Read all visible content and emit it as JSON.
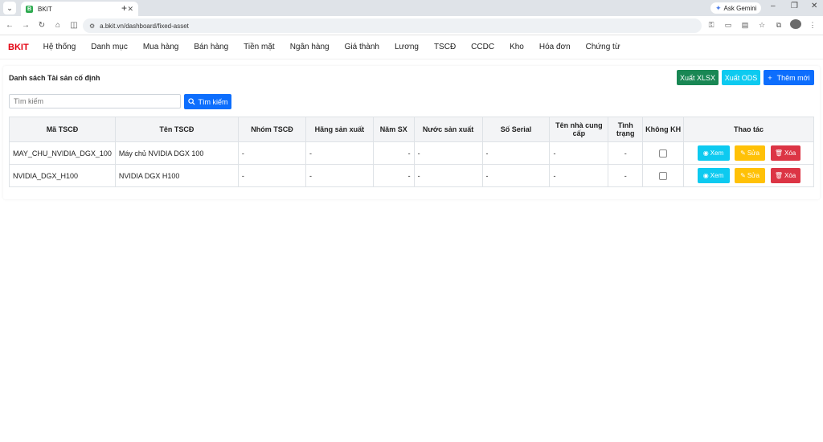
{
  "browser": {
    "tab_title": "BKIT",
    "tab_favicon": "B",
    "gemini_label": "Ask Gemini",
    "url": "a.bkit.vn/dashboard/fixed-asset"
  },
  "nav": {
    "brand": "BKIT",
    "items": [
      "Hệ thống",
      "Danh mục",
      "Mua hàng",
      "Bán hàng",
      "Tiền mặt",
      "Ngân hàng",
      "Giá thành",
      "Lương",
      "TSCĐ",
      "CCDC",
      "Kho",
      "Hóa đơn",
      "Chứng từ"
    ]
  },
  "page": {
    "title": "Danh sách Tài sản cố định",
    "export_xlsx": "Xuất XLSX",
    "export_ods": "Xuất ODS",
    "add_new": "Thêm mới",
    "search_placeholder": "Tìm kiếm",
    "search_button": "Tìm kiếm"
  },
  "table": {
    "headers": [
      "Mã TSCĐ",
      "Tên TSCĐ",
      "Nhóm TSCĐ",
      "Hãng sản xuất",
      "Năm SX",
      "Nước sản xuất",
      "Số Serial",
      "Tên nhà cung cấp",
      "Tình trạng",
      "Không KH",
      "Thao tác"
    ],
    "rows": [
      {
        "code": "MAY_CHU_NVIDIA_DGX_100",
        "name": "Máy chủ NVIDIA DGX 100",
        "group": "-",
        "maker": "-",
        "year": "-",
        "country": "-",
        "serial": "-",
        "supplier": "-",
        "status": "-"
      },
      {
        "code": "NVIDIA_DGX_H100",
        "name": "NVIDIA DGX H100",
        "group": "-",
        "maker": "-",
        "year": "-",
        "country": "-",
        "serial": "-",
        "supplier": "-",
        "status": "-"
      }
    ],
    "actions": {
      "view": "Xem",
      "edit": "Sửa",
      "delete": "Xóa"
    }
  },
  "colors": {
    "brand": "#e3000f",
    "success": "#198754",
    "info": "#0dcaf0",
    "primary": "#0d6efd",
    "warning": "#ffc107",
    "danger": "#dc3545"
  }
}
